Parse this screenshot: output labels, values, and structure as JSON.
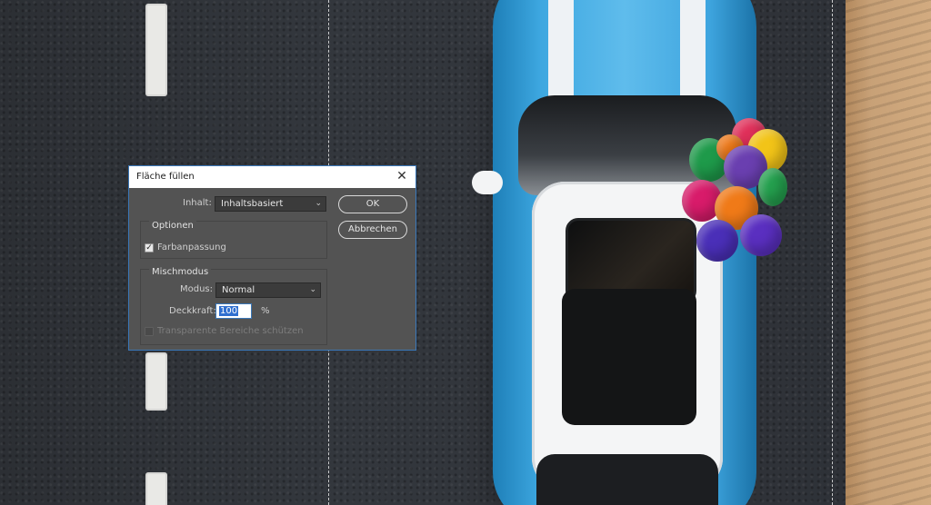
{
  "dialog": {
    "title": "Fläche füllen",
    "close_glyph": "✕",
    "inhalt_label": "Inhalt:",
    "inhalt_value": "Inhaltsbasiert",
    "ok_label": "OK",
    "cancel_label": "Abbrechen",
    "optionen_title": "Optionen",
    "farbanpassung_label": "Farbanpassung",
    "farbanpassung_checked": true,
    "check_glyph": "✓",
    "mischmodus_title": "Mischmodus",
    "modus_label": "Modus:",
    "modus_value": "Normal",
    "deckkraft_label": "Deckkraft:",
    "deckkraft_value": "100",
    "deckkraft_unit": "%",
    "transparent_label": "Transparente Bereiche schützen",
    "transparent_checked": false,
    "dropdown_glyph": "⌄"
  },
  "colors": {
    "dialog_bg": "#535353",
    "accent": "#3a77b8",
    "selection": "#2f6fd0"
  },
  "icons": {
    "close": "close-icon",
    "check": "checkmark-icon",
    "dropdown": "chevron-down-icon"
  }
}
